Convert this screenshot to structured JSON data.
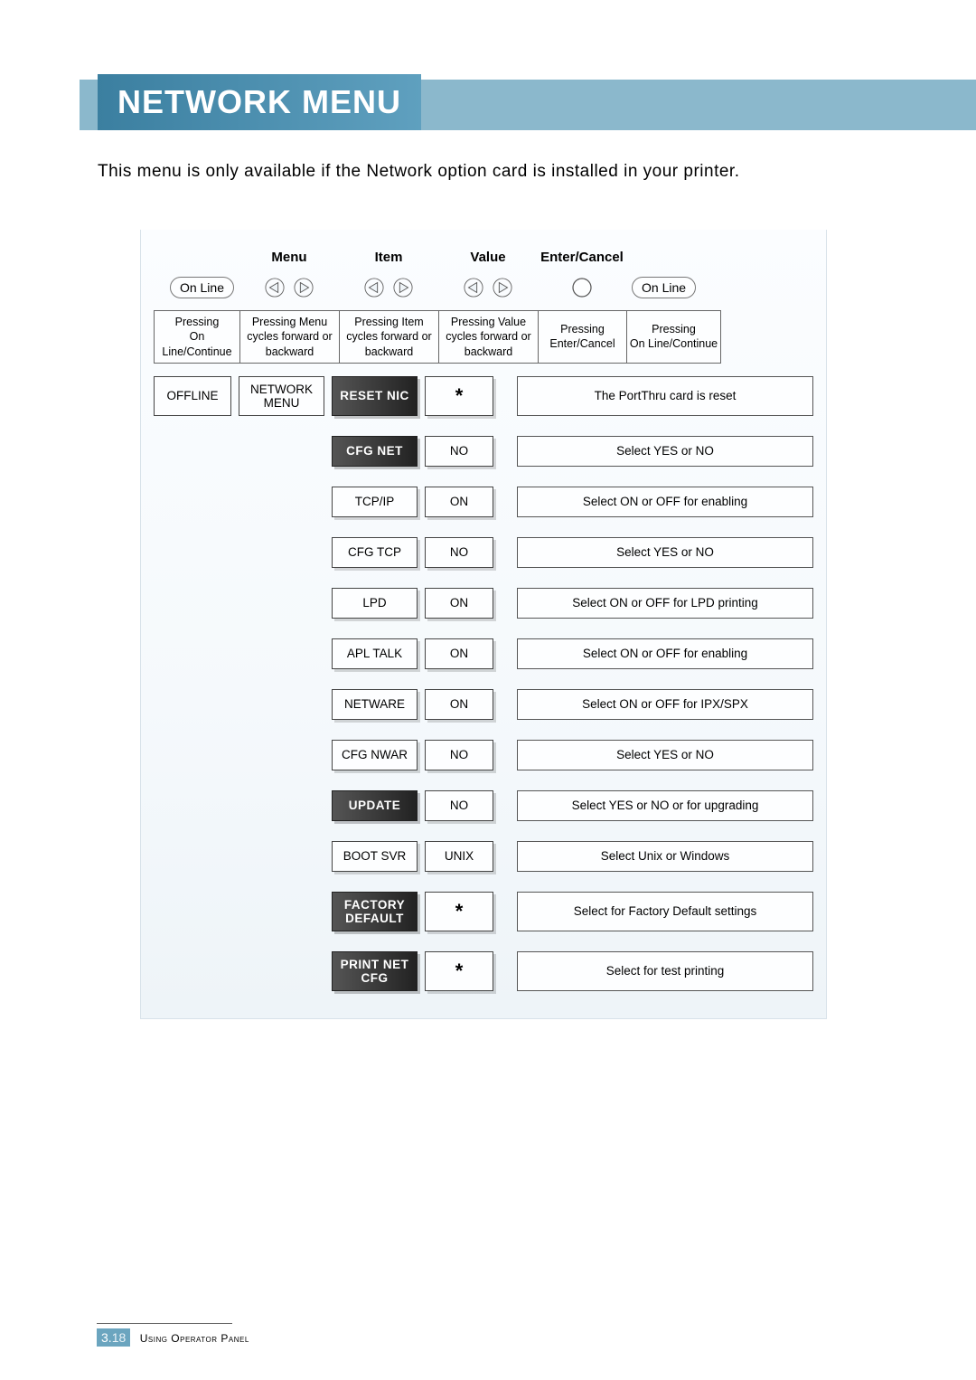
{
  "title": "NETWORK MENU",
  "intro": "This menu is only available if the Network option card is installed in your printer.",
  "columns": {
    "menu": "Menu",
    "item": "Item",
    "value": "Value",
    "enter_cancel": "Enter/Cancel",
    "on_line_left": "On Line",
    "on_line_right": "On Line"
  },
  "col_desc": {
    "c0": "Pressing\nOn Line/Continue",
    "c1": "Pressing Menu cycles forward or backward",
    "c2": "Pressing Item cycles forward or backward",
    "c3": "Pressing Value cycles forward or backward",
    "c4": "Pressing\nEnter/Cancel",
    "c5": "Pressing\nOn Line/Continue"
  },
  "first_row": {
    "status": "OFFLINE",
    "menu": "NETWORK MENU"
  },
  "rows": [
    {
      "item": "RESET NIC",
      "dark": true,
      "value": "*",
      "star": true,
      "desc": "The PortThru card is reset"
    },
    {
      "item": "CFG NET",
      "dark": true,
      "value": "NO",
      "star": false,
      "desc": "Select YES or NO"
    },
    {
      "item": "TCP/IP",
      "dark": false,
      "value": "ON",
      "star": false,
      "desc": "Select ON or OFF for enabling"
    },
    {
      "item": "CFG TCP",
      "dark": false,
      "value": "NO",
      "star": false,
      "desc": "Select YES or NO"
    },
    {
      "item": "LPD",
      "dark": false,
      "value": "ON",
      "star": false,
      "desc": "Select ON or OFF for LPD printing"
    },
    {
      "item": "APL TALK",
      "dark": false,
      "value": "ON",
      "star": false,
      "desc": "Select ON or OFF for enabling"
    },
    {
      "item": "NETWARE",
      "dark": false,
      "value": "ON",
      "star": false,
      "desc": "Select ON or OFF for IPX/SPX"
    },
    {
      "item": "CFG NWAR",
      "dark": false,
      "value": "NO",
      "star": false,
      "desc": "Select YES or NO"
    },
    {
      "item": "UPDATE",
      "dark": true,
      "value": "NO",
      "star": false,
      "desc": "Select YES or NO or for upgrading"
    },
    {
      "item": "BOOT SVR",
      "dark": false,
      "value": "UNIX",
      "star": false,
      "desc": "Select Unix or Windows"
    },
    {
      "item": "FACTORY DEFAULT",
      "dark": true,
      "value": "*",
      "star": true,
      "desc": "Select for Factory Default settings"
    },
    {
      "item": "PRINT NET CFG",
      "dark": true,
      "value": "*",
      "star": true,
      "desc": "Select for test printing"
    }
  ],
  "footer": {
    "chapter": "3.",
    "page": "18",
    "label": "Using Operator Panel"
  }
}
